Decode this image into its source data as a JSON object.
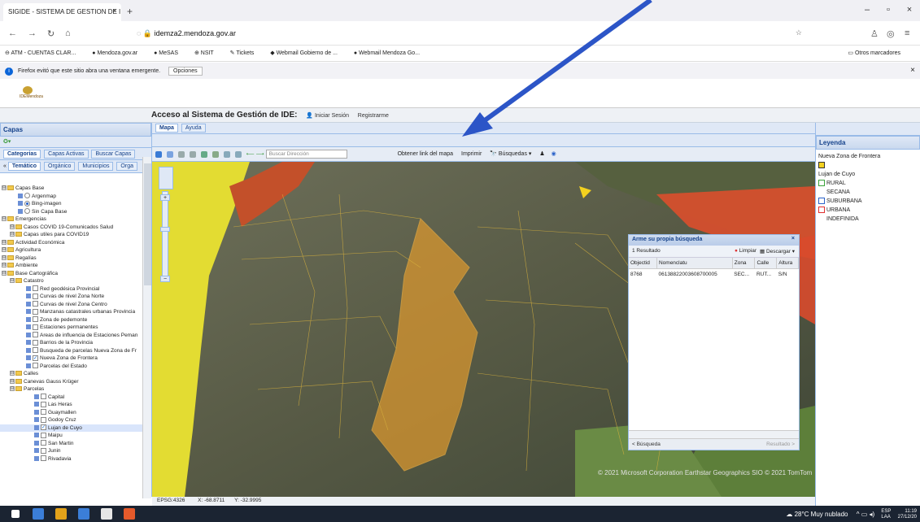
{
  "browser": {
    "tab_title": "SIGIDE - SISTEMA DE GESTION DE I",
    "url_domain": "idemza2.mendoza.gov.ar",
    "bookmarks": [
      "ATM - CUENTAS CLAR...",
      "Mendoza.gov.ar",
      "MeSAS",
      "NSIT",
      "Tickets",
      "Webmail Gobierno de ...",
      "Webmail Mendoza Go..."
    ],
    "other_bookmarks": "Otros marcadores",
    "notice_text": "Firefox evitó que este sitio abra una ventana emergente.",
    "notice_button": "Opciones"
  },
  "app": {
    "logo_text": "IDEMendoza",
    "access_title": "Acceso al Sistema de Gestión de IDE:",
    "login_link": "Iniciar Sesión",
    "register_link": "Registrarme"
  },
  "left_panel": {
    "title": "Capas",
    "top_tabs": [
      "Categorias",
      "Capas Activas",
      "Buscar Capas"
    ],
    "sub_tabs": [
      "Temático",
      "Orgánico",
      "Municipios",
      "Orga"
    ],
    "tree": [
      {
        "label": "Capas Base",
        "kind": "folder",
        "level": 0
      },
      {
        "label": "Argenmap",
        "kind": "radio",
        "level": 2,
        "on": false
      },
      {
        "label": "Bing-imagen",
        "kind": "radio",
        "level": 2,
        "on": true
      },
      {
        "label": "Sin Capa Base",
        "kind": "radio",
        "level": 2,
        "on": false
      },
      {
        "label": "Emergencias",
        "kind": "folder",
        "level": 0
      },
      {
        "label": "Casos COVID 19-Comunicados Salud",
        "kind": "folder",
        "level": 1
      },
      {
        "label": "Capas utiles para COVID19",
        "kind": "folder",
        "level": 1
      },
      {
        "label": "Actividad Económica",
        "kind": "folder",
        "level": 0
      },
      {
        "label": "Agricultura",
        "kind": "folder",
        "level": 0
      },
      {
        "label": "Regalías",
        "kind": "folder",
        "level": 0
      },
      {
        "label": "Ambiente",
        "kind": "folder",
        "level": 0
      },
      {
        "label": "Base Cartográfica",
        "kind": "folder",
        "level": 0
      },
      {
        "label": "Catastro",
        "kind": "folder",
        "level": 1
      },
      {
        "label": "Red geodésica Provincial",
        "kind": "check",
        "level": 3,
        "on": false
      },
      {
        "label": "Curvas de nivel Zona Norte",
        "kind": "check",
        "level": 3,
        "on": false
      },
      {
        "label": "Curvas de nivel Zona Centro",
        "kind": "check",
        "level": 3,
        "on": false
      },
      {
        "label": "Manzanas catastrales urbanas Provincia",
        "kind": "check",
        "level": 3,
        "on": false
      },
      {
        "label": "Zona de pedemonte",
        "kind": "check",
        "level": 3,
        "on": false
      },
      {
        "label": "Estaciones permanentes",
        "kind": "check",
        "level": 3,
        "on": false
      },
      {
        "label": "Areas de influencia de Estaciones Peman",
        "kind": "check",
        "level": 3,
        "on": false
      },
      {
        "label": "Barrios de la Provincia",
        "kind": "check",
        "level": 3,
        "on": false
      },
      {
        "label": "Busqueda de parcelas Nueva Zona de Fr",
        "kind": "check",
        "level": 3,
        "on": false
      },
      {
        "label": "Nueva Zona de Frontera",
        "kind": "check",
        "level": 3,
        "on": true
      },
      {
        "label": "Parcelas del Estado",
        "kind": "check",
        "level": 3,
        "on": false
      },
      {
        "label": "Calles",
        "kind": "folder",
        "level": 1
      },
      {
        "label": "Canevas Gauss Krüger",
        "kind": "folder",
        "level": 1
      },
      {
        "label": "Parcelas",
        "kind": "folder",
        "level": 1
      },
      {
        "label": "Capital",
        "kind": "check",
        "level": 4,
        "on": false
      },
      {
        "label": "Las Heras",
        "kind": "check",
        "level": 4,
        "on": false
      },
      {
        "label": "Guaymallen",
        "kind": "check",
        "level": 4,
        "on": false
      },
      {
        "label": "Godoy Cruz",
        "kind": "check",
        "level": 4,
        "on": false
      },
      {
        "label": "Lujan de Cuyo",
        "kind": "check",
        "level": 4,
        "on": true,
        "selected": true
      },
      {
        "label": "Maipu",
        "kind": "check",
        "level": 4,
        "on": false
      },
      {
        "label": "San Martin",
        "kind": "check",
        "level": 4,
        "on": false
      },
      {
        "label": "Junin",
        "kind": "check",
        "level": 4,
        "on": false
      },
      {
        "label": "Rivadavia",
        "kind": "check",
        "level": 4,
        "on": false
      }
    ]
  },
  "map": {
    "tabs": [
      "Mapa",
      "Ayuda"
    ],
    "search_placeholder": "Buscar Dirección",
    "link_button": "Obtener link del mapa",
    "print_button": "Imprimir",
    "search_menu": "Búsquedas",
    "copyright": "© 2021 Microsoft Corporation Earthstar Geographics SIO © 2021 TomTom",
    "epsg": "EPSG:4326",
    "x_coord": "X: -68.8711",
    "y_coord": "Y: -32.9995"
  },
  "result_window": {
    "title": "Arme su propia búsqueda",
    "count": "1 Resultado",
    "clear_button": "Limpiar",
    "download_button": "Descargar",
    "columns": [
      "Objectid",
      "Nomenclatu",
      "Zona",
      "Calle",
      "Altura"
    ],
    "rows": [
      [
        "8768",
        "06138822003608700005",
        "SEC...",
        "RUT...",
        "S/N"
      ]
    ],
    "back_button": "< Búsqueda",
    "next_button": "Resultado >"
  },
  "legend": {
    "title": "Leyenda",
    "group1": "Nueva Zona de Frontera",
    "group2": "Lujan de Cuyo",
    "items": [
      {
        "label": "RURAL",
        "color": "#ffffff",
        "border": "#3aa33a"
      },
      {
        "label": "SECANA",
        "color": "#ffffff",
        "border": "#ffffff"
      },
      {
        "label": "SUBURBANA",
        "color": "#ffffff",
        "border": "#2a62c9"
      },
      {
        "label": "URBANA",
        "color": "#ffffff",
        "border": "#e03030"
      },
      {
        "label": "INDEFINIDA",
        "color": "#ffffff",
        "border": "#ffffff"
      }
    ]
  },
  "taskbar": {
    "weather": "28°C  Muy nublado",
    "lang": "ESP",
    "lang2": "LAA",
    "time": "11:19",
    "date": "27/12/20"
  }
}
